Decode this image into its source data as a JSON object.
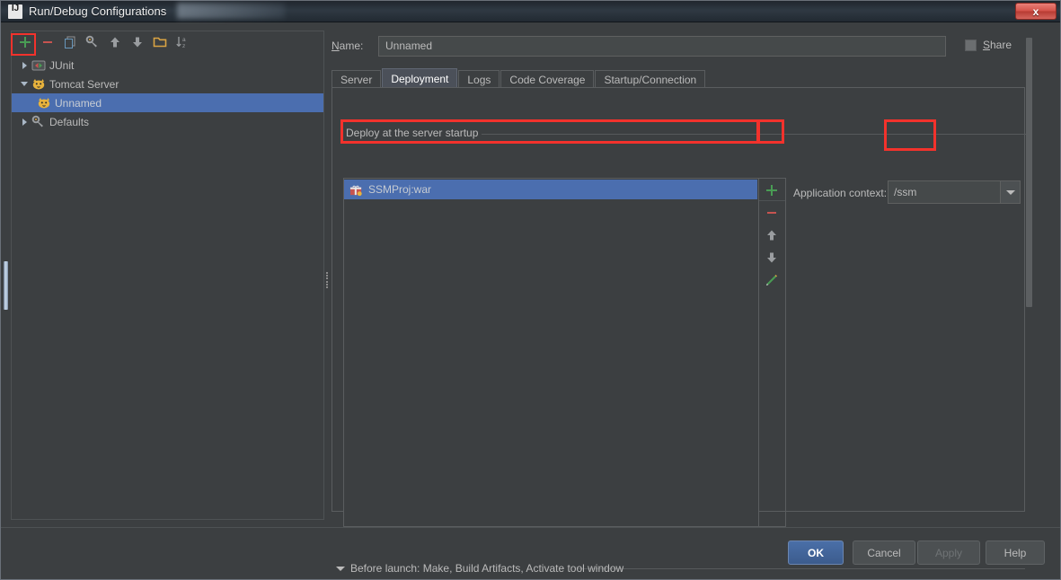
{
  "window": {
    "title": "Run/Debug Configurations",
    "app_icon": "intellij-idea-icon",
    "close_label": "x"
  },
  "left_panel": {
    "toolbar": [
      {
        "name": "add-configuration-button",
        "icon": "plus-icon",
        "label": "+"
      },
      {
        "name": "remove-configuration-button",
        "icon": "minus-icon",
        "label": "−"
      },
      {
        "name": "copy-configuration-button",
        "icon": "copy-icon",
        "label": "Copy"
      },
      {
        "name": "save-configuration-button",
        "icon": "wrench-icon",
        "label": "Save"
      },
      {
        "name": "move-up-button",
        "icon": "arrow-up-icon",
        "label": "Move Up"
      },
      {
        "name": "move-down-button",
        "icon": "arrow-down-icon",
        "label": "Move Down"
      },
      {
        "name": "create-folder-button",
        "icon": "folder-icon",
        "label": "Create Folder"
      },
      {
        "name": "sort-configurations-button",
        "icon": "sort-alphabetical-icon",
        "label": "Sort"
      }
    ],
    "tree": [
      {
        "label": "JUnit",
        "icon": "junit-icon",
        "expanded": false,
        "selected": false,
        "child": false
      },
      {
        "label": "Tomcat Server",
        "icon": "tomcat-icon",
        "expanded": true,
        "selected": false,
        "child": false
      },
      {
        "label": "Unnamed",
        "icon": "tomcat-icon",
        "expanded": null,
        "selected": true,
        "child": true
      },
      {
        "label": "Defaults",
        "icon": "wrench-icon",
        "expanded": false,
        "selected": false,
        "child": false
      }
    ]
  },
  "config": {
    "name_label": "Name:",
    "name_label_mnemonic": "N",
    "name_value": "Unnamed",
    "share_label": "Share",
    "share_label_mnemonic": "S",
    "share_checked": false
  },
  "tabs": [
    {
      "label": "Server",
      "active": false
    },
    {
      "label": "Deployment",
      "active": true
    },
    {
      "label": "Logs",
      "active": false
    },
    {
      "label": "Code Coverage",
      "active": false
    },
    {
      "label": "Startup/Connection",
      "active": false
    }
  ],
  "deployment": {
    "group_title": "Deploy at the server startup",
    "artifacts": [
      {
        "label": "SSMProj:war",
        "icon": "war-artifact-icon",
        "selected": true
      }
    ],
    "side_toolbar": [
      {
        "name": "add-artifact-button",
        "icon": "plus-icon",
        "label": "+"
      },
      {
        "name": "remove-artifact-button",
        "icon": "minus-icon",
        "label": "−"
      },
      {
        "name": "move-artifact-up-button",
        "icon": "arrow-up-icon",
        "label": "Move Up"
      },
      {
        "name": "move-artifact-down-button",
        "icon": "arrow-down-icon",
        "label": "Move Down"
      },
      {
        "name": "edit-artifact-button",
        "icon": "pencil-icon",
        "label": "Edit"
      }
    ],
    "application_context_label": "Application context:",
    "application_context_value": "/ssm"
  },
  "before_launch": {
    "label": "Before launch: Make, Build Artifacts, Activate tool window",
    "mnemonic": "B",
    "expanded": false
  },
  "footer": {
    "ok": "OK",
    "cancel": "Cancel",
    "apply": "Apply",
    "help": "Help"
  },
  "highlights": {
    "color": "#f3322c",
    "regions": [
      "add-configuration-button",
      "deployment-artifact-row",
      "add-artifact-button",
      "application-context-field"
    ]
  }
}
